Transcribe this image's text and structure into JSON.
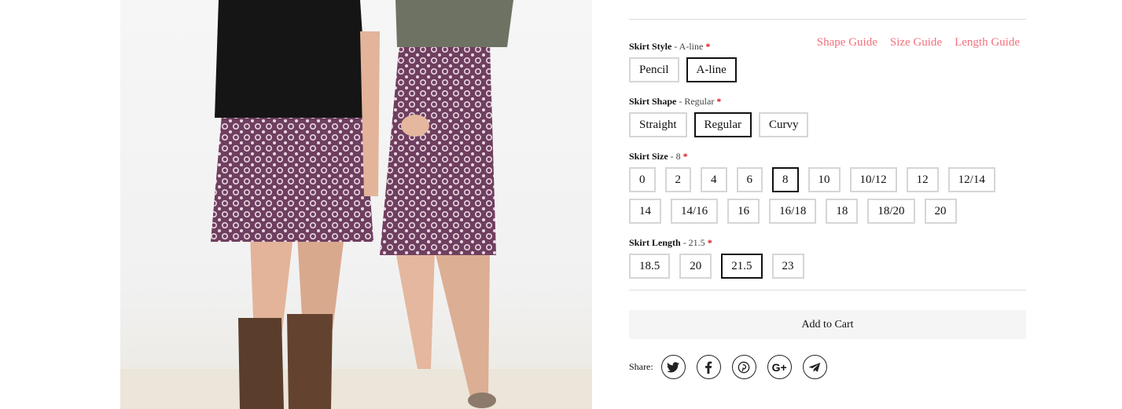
{
  "guides": {
    "shape": "Shape Guide",
    "size": "Size Guide",
    "length": "Length Guide"
  },
  "style": {
    "label": "Skirt Style",
    "selected_text": " - A-line",
    "required": "*",
    "options": [
      "Pencil",
      "A-line"
    ],
    "active": "A-line"
  },
  "shape": {
    "label": "Skirt Shape",
    "selected_text": " - Regular",
    "required": "*",
    "options": [
      "Straight",
      "Regular",
      "Curvy"
    ],
    "active": "Regular"
  },
  "size": {
    "label": "Skirt Size",
    "selected_text": " - 8",
    "required": "*",
    "options_row1": [
      "0",
      "2",
      "4",
      "6",
      "8",
      "10",
      "10/12",
      "12",
      "12/14"
    ],
    "options_row2": [
      "14",
      "14/16",
      "16",
      "16/18",
      "18",
      "18/20",
      "20"
    ],
    "active": "8"
  },
  "length": {
    "label": "Skirt Length",
    "selected_text": " - 21.5",
    "required": "*",
    "options": [
      "18.5",
      "20",
      "21.5",
      "23"
    ],
    "active": "21.5"
  },
  "cart": {
    "label": "Add to Cart"
  },
  "share": {
    "label": "Share:",
    "icons": [
      "twitter-icon",
      "facebook-icon",
      "pinterest-icon",
      "google-plus-icon",
      "telegram-icon"
    ],
    "g_plus_text": "G+"
  },
  "colors": {
    "accent": "#f2707c",
    "required": "#e0111b",
    "border": "#d6d6d6",
    "active_border": "#111111"
  }
}
